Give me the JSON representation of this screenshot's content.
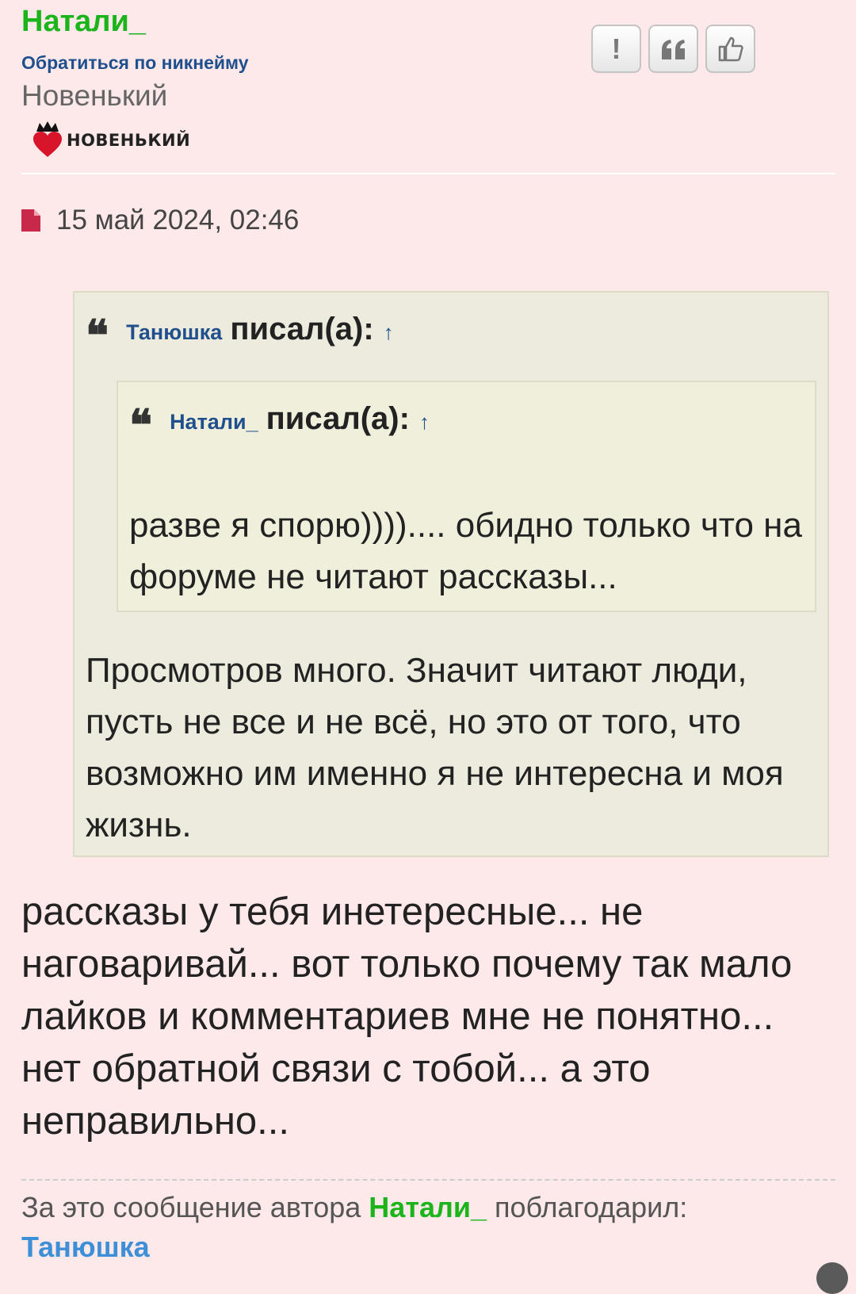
{
  "author": {
    "name": "Натали_",
    "mention_link": "Обратиться по никнейму",
    "rank_title": "Новенький",
    "rank_badge": "НОВЕНЬКИЙ"
  },
  "actions": [
    {
      "name": "report",
      "icon": "exclamation-icon",
      "glyph": "!"
    },
    {
      "name": "quote",
      "icon": "quote-icon"
    },
    {
      "name": "like",
      "icon": "thumbs-up-icon"
    }
  ],
  "post": {
    "date": "15 май 2024, 02:46",
    "body": "рассказы у тебя инетересные... не наговаривай... вот только почему так мало лайков и комментариев мне не понятно... нет обратной связи с тобой... а это неправильно..."
  },
  "quote_outer": {
    "mark": "❝",
    "author": "Танюшка",
    "wrote": "писал(а):",
    "up_arrow": "↑",
    "text": "Просмотров много. Значит читают люди, пусть не все и не всё, но это от того, что возможно им именно я не интересна и моя жизнь."
  },
  "quote_inner": {
    "mark": "❝",
    "author": "Натали_",
    "wrote": "писал(а):",
    "up_arrow": "↑",
    "text": "разве я спорю)))).... обидно только что на форуме не читают рассказы..."
  },
  "thanks": {
    "prefix": "За это сообщение автора",
    "author": "Натали_",
    "suffix": "поблагодарил:",
    "user": "Танюшка"
  },
  "colors": {
    "background": "#fde8ea",
    "username_green": "#1bb51b",
    "link_blue": "#1f4f8c",
    "quote_bg": "#ecebde"
  }
}
